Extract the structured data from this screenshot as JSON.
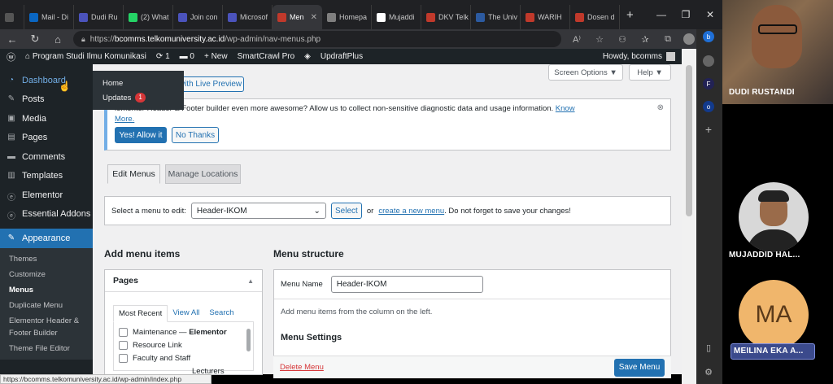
{
  "browser": {
    "tabs": [
      {
        "label": "Mail - Di",
        "color": "#0a66c2"
      },
      {
        "label": "Dudi Ru",
        "color": "#4b53bc"
      },
      {
        "label": "(2) What",
        "color": "#25d366"
      },
      {
        "label": "Join con",
        "color": "#4b53bc"
      },
      {
        "label": "Microsof",
        "color": "#4b53bc"
      },
      {
        "label": "Men",
        "color": "#c0392b"
      },
      {
        "label": "Homepa",
        "color": "#7f7f7f"
      },
      {
        "label": "Mujaddi",
        "color": "#ffffff"
      },
      {
        "label": "DKV Telk",
        "color": "#c0392b"
      },
      {
        "label": "The Univ",
        "color": "#2c5aa0"
      },
      {
        "label": "WARIH",
        "color": "#c0392b"
      },
      {
        "label": "Dosen d",
        "color": "#c0392b"
      }
    ],
    "url_prefix": "https://",
    "url_domain": "bcomms.telkomuniversity.ac.id",
    "url_path": "/wp-admin/nav-menus.php",
    "status_url": "https://bcomms.telkomuniversity.ac.id/wp-admin/index.php"
  },
  "adminbar": {
    "site": "Program Studi Ilmu Komunikasi",
    "updates": "1",
    "comments": "0",
    "new": "+ New",
    "smartcrawl": "SmartCrawl Pro",
    "updraft": "UpdraftPlus",
    "howdy": "Howdy, bcomms"
  },
  "sidebar": {
    "items": [
      {
        "label": "Dashboard",
        "icon": "dashboard-icon",
        "glyph": "◔"
      },
      {
        "label": "Posts",
        "icon": "pin-icon",
        "glyph": "✎"
      },
      {
        "label": "Media",
        "icon": "media-icon",
        "glyph": "▣"
      },
      {
        "label": "Pages",
        "icon": "page-icon",
        "glyph": "▤"
      },
      {
        "label": "Comments",
        "icon": "comment-icon",
        "glyph": "▬"
      },
      {
        "label": "Templates",
        "icon": "folder-icon",
        "glyph": "▥"
      },
      {
        "label": "Elementor",
        "icon": "elementor-icon",
        "glyph": "ⓔ"
      },
      {
        "label": "Essential Addons",
        "icon": "addons-icon",
        "glyph": "ⓔ"
      }
    ],
    "appearance": "Appearance",
    "submenu": [
      "Themes",
      "Customize",
      "Menus",
      "Duplicate Menu",
      "Elementor Header &",
      "Footer Builder",
      "Theme File Editor"
    ],
    "flyout": {
      "home": "Home",
      "updates": "Updates",
      "badge": "1"
    }
  },
  "content": {
    "live_preview": "with Live Preview",
    "screen_options": "Screen Options ▼",
    "help": "Help ▼",
    "notice_text": "lementor Header & Footer builder even more awesome? Allow us to collect non-sensitive diagnostic data and usage information. ",
    "notice_link1": "Know",
    "notice_link2": "More.",
    "allow": "Yes! Allow it",
    "no_thanks": "No Thanks",
    "tab_edit": "Edit Menus",
    "tab_manage": "Manage Locations",
    "select_label": "Select a menu to edit:",
    "select_value": "Header-IKOM",
    "select_btn": "Select",
    "or": "or",
    "create_link": "create a new menu",
    "create_after": ". Do not forget to save your changes!",
    "add_items": "Add menu items",
    "menu_structure": "Menu structure",
    "pages_title": "Pages",
    "pages_tabs": [
      "Most Recent",
      "View All",
      "Search"
    ],
    "pages": [
      {
        "prefix": "Maintenance — ",
        "bold": "Elementor"
      },
      {
        "prefix": "Resource Link",
        "bold": ""
      },
      {
        "prefix": "Faculty and Staff",
        "bold": ""
      },
      {
        "prefix": "Lecturers",
        "bold": ""
      }
    ],
    "menu_name_label": "Menu Name",
    "menu_name_value": "Header-IKOM",
    "add_hint": "Add menu items from the column on the left.",
    "menu_settings": "Menu Settings",
    "delete": "Delete Menu",
    "save": "Save Menu"
  },
  "participants": [
    {
      "name": "DUDI RUSTANDI"
    },
    {
      "name": "MUJADDID HAL..."
    },
    {
      "name": "MEILINA EKA A...",
      "initials": "MA"
    }
  ]
}
